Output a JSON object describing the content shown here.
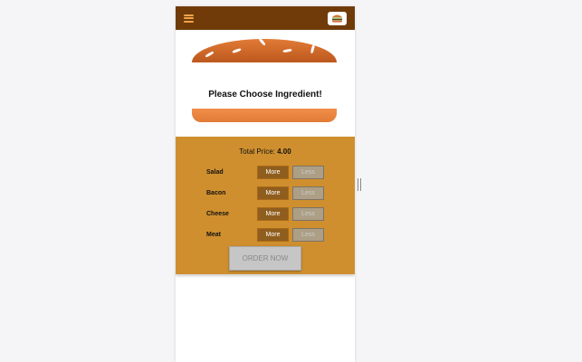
{
  "toolbar": {
    "menu_icon": "hamburger-icon",
    "logo_icon": "burger-logo-icon",
    "bg_color": "#703b09"
  },
  "burger": {
    "prompt": "Please Choose Ingredient!"
  },
  "controls": {
    "price_label": "Total Price:",
    "price_value": "4.00",
    "ingredients": [
      {
        "label": "Salad",
        "more": "More",
        "less": "Less"
      },
      {
        "label": "Bacon",
        "more": "More",
        "less": "Less"
      },
      {
        "label": "Cheese",
        "more": "More",
        "less": "Less"
      },
      {
        "label": "Meat",
        "more": "More",
        "less": "Less"
      }
    ],
    "order_button": "ORDER NOW",
    "bg_color": "#cf8f2e"
  }
}
